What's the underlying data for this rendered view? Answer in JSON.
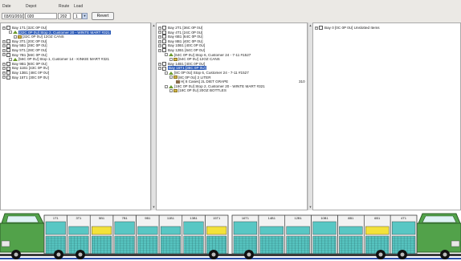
{
  "toolbar": {
    "date_label": "Date",
    "depot_label": "Depot",
    "route_label": "Route",
    "load_label": "Load",
    "date_value": "03/01/2010",
    "depot_value": "020",
    "route_value": "202",
    "load_value": "1",
    "revert_label": "Revert"
  },
  "left_pane": {
    "rows": [
      {
        "type": "bay",
        "label": "Bay 1T1   [32C 0P 0U]"
      },
      {
        "type": "stop",
        "label": "[32C 0P 0U] Stop 2, Customer 20 - WINTE MART #321",
        "selected": true
      },
      {
        "type": "product",
        "label": "[32C 0P 0U] 12OZ CANS"
      },
      {
        "type": "bay",
        "label": "Bay 3T1   [20C 0P 0U]"
      },
      {
        "type": "bay",
        "label": "Bay 5B1   [28C 0P 0U]"
      },
      {
        "type": "bay",
        "label": "Bay 5T1   [28C 0P 0U]"
      },
      {
        "type": "bay",
        "label": "Bay 7B1   [56C 0P 0U]"
      },
      {
        "type": "stop",
        "label": "[56C 0P 0U] Stop 1, Customer 14 - KINKIE MART #321"
      },
      {
        "type": "bay",
        "label": "Bay 9B1   [60C 0P 0U]"
      },
      {
        "type": "bay",
        "label": "Bay 11B1  [43C 0P 0U]"
      },
      {
        "type": "bay",
        "label": "Bay 13B1  [48C 0P 0U]"
      },
      {
        "type": "bay",
        "label": "Bay 15T1  [30C 0P 0U]"
      }
    ]
  },
  "middle_pane": {
    "rows": [
      {
        "type": "bay",
        "label": "Bay 2T1   [36C 0P 0U]"
      },
      {
        "type": "bay",
        "label": "Bay 4T1   [24C 0P 0U]"
      },
      {
        "type": "bay",
        "label": "Bay 6B1   [64C 0P 0U]"
      },
      {
        "type": "bay",
        "label": "Bay 8B1   [40C 0P 0U]"
      },
      {
        "type": "bay",
        "label": "Bay 10B1  [40C 0P 0U]"
      },
      {
        "type": "bay",
        "label": "Bay 12B1  [64C 0P 0U]"
      },
      {
        "type": "stop",
        "label": "[64C 0P 0U] Stop 6, Customer 24 - 7-11 #1527"
      },
      {
        "type": "product",
        "label": "[64C 0P 0U] 12OZ CANS"
      },
      {
        "type": "bay",
        "label": "Bay 14B1  [40C 0P 0U]"
      },
      {
        "type": "bay",
        "label": "Bay 16T1  [36C 0P 0U]",
        "selected": true
      },
      {
        "type": "stop",
        "label": "[8C 0P 0U] Stop 6, Customer 24 - 7-11 #1527"
      },
      {
        "type": "product",
        "label": "[8C 0P 0U] 2 LITER"
      },
      {
        "type": "pallet",
        "label": "H[ 8 Cases] 2L DIET GRAPE",
        "qty": "310"
      },
      {
        "type": "stop",
        "label": "[18C 0P 0U] Stop 2, Customer 20 - WINTE MART #321"
      },
      {
        "type": "product",
        "label": "[18C 0P 0U] 20OZ BOTTLES"
      }
    ]
  },
  "right_pane": {
    "rows": [
      {
        "type": "bay",
        "label": "Bay 0   [0C 0P 0U] Unslotted Items"
      }
    ]
  },
  "truck_graphic": {
    "bay_labels_left": [
      "1T1",
      "3T1",
      "5B1",
      "7B1",
      "9B1",
      "11B1",
      "13B1",
      "15T1"
    ],
    "bay_labels_right": [
      "16T1",
      "14B1",
      "12B1",
      "10B1",
      "8B1",
      "6B1",
      "4T1"
    ],
    "colors": {
      "cab": "#52a24a",
      "trailer": "#58c7c4",
      "highlight": "#f3e23a",
      "frame": "#3c3c3c"
    }
  }
}
